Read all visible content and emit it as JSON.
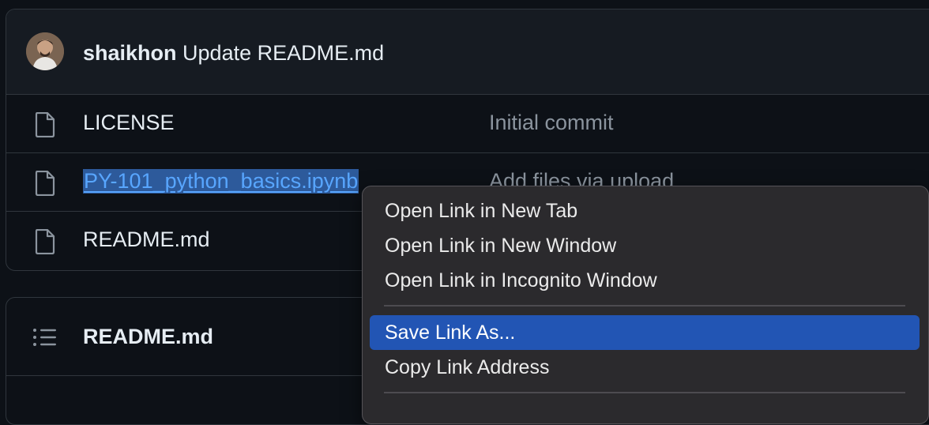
{
  "latest_commit": {
    "author": "shaikhon",
    "message": "Update README.md"
  },
  "files": [
    {
      "name": "LICENSE",
      "commit_message": "Initial commit"
    },
    {
      "name": "PY-101_python_basics.ipynb",
      "commit_message": "Add files via upload"
    },
    {
      "name": "README.md",
      "commit_message": ""
    }
  ],
  "readme": {
    "title": "README.md"
  },
  "context_menu": {
    "items": [
      {
        "label": "Open Link in New Tab"
      },
      {
        "label": "Open Link in New Window"
      },
      {
        "label": "Open Link in Incognito Window"
      },
      {
        "label": "Save Link As..."
      },
      {
        "label": "Copy Link Address"
      }
    ],
    "highlighted": "Save Link As..."
  },
  "colors": {
    "background": "#0d1117",
    "link": "#4493f8",
    "menu_highlight": "#2255b4"
  },
  "icons": [
    "file-icon",
    "list-icon",
    "avatar"
  ]
}
